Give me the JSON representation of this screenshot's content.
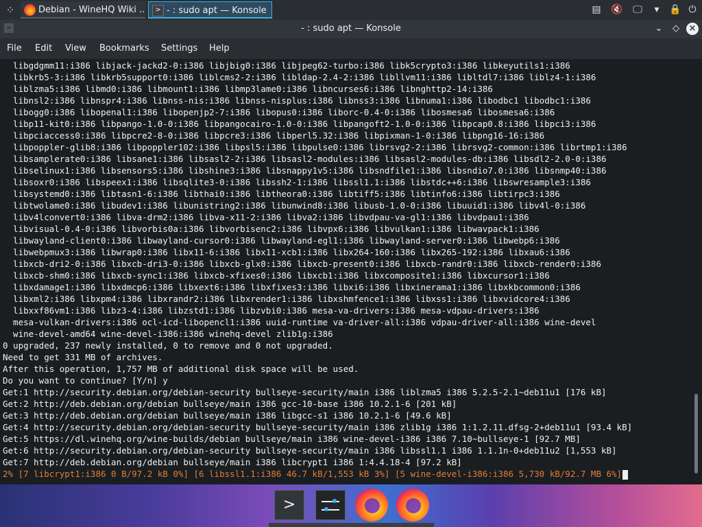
{
  "taskbar": {
    "tasks": [
      {
        "label": "Debian - WineHQ Wiki ..."
      },
      {
        "label": "- : sudo apt — Konsole"
      }
    ]
  },
  "window": {
    "title": "- : sudo apt — Konsole"
  },
  "menu": [
    "File",
    "Edit",
    "View",
    "Bookmarks",
    "Settings",
    "Help"
  ],
  "terminal": {
    "lines": [
      "  libgdgmm11:i386 libjack-jackd2-0:i386 libjbig0:i386 libjpeg62-turbo:i386 libk5crypto3:i386 libkeyutils1:i386",
      "  libkrb5-3:i386 libkrb5support0:i386 liblcms2-2:i386 libldap-2.4-2:i386 libllvm11:i386 libltdl7:i386 liblz4-1:i386",
      "  liblzma5:i386 libmd0:i386 libmount1:i386 libmp3lame0:i386 libncurses6:i386 libnghttp2-14:i386",
      "  libnsl2:i386 libnspr4:i386 libnss-nis:i386 libnss-nisplus:i386 libnss3:i386 libnuma1:i386 libodbc1 libodbc1:i386",
      "  libogg0:i386 libopenal1:i386 libopenjp2-7:i386 libopus0:i386 liborc-0.4-0:i386 libosmesa6 libosmesa6:i386",
      "  libp11-kit0:i386 libpango-1.0-0:i386 libpangocairo-1.0-0:i386 libpangoft2-1.0-0:i386 libpcap0.8:i386 libpci3:i386",
      "  libpciaccess0:i386 libpcre2-8-0:i386 libpcre3:i386 libperl5.32:i386 libpixman-1-0:i386 libpng16-16:i386",
      "  libpoppler-glib8:i386 libpoppler102:i386 libpsl5:i386 libpulse0:i386 librsvg2-2:i386 librsvg2-common:i386 librtmp1:i386",
      "  libsamplerate0:i386 libsane1:i386 libsasl2-2:i386 libsasl2-modules:i386 libsasl2-modules-db:i386 libsdl2-2.0-0:i386",
      "  libselinux1:i386 libsensors5:i386 libshine3:i386 libsnappy1v5:i386 libsndfile1:i386 libsndio7.0:i386 libsnmp40:i386",
      "  libsoxr0:i386 libspeex1:i386 libsqlite3-0:i386 libssh2-1:i386 libssl1.1:i386 libstdc++6:i386 libswresample3:i386",
      "  libsystemd0:i386 libtasn1-6:i386 libthai0:i386 libtheora0:i386 libtiff5:i386 libtinfo6:i386 libtirpc3:i386",
      "  libtwolame0:i386 libudev1:i386 libunistring2:i386 libunwind8:i386 libusb-1.0-0:i386 libuuid1:i386 libv4l-0:i386",
      "  libv4lconvert0:i386 libva-drm2:i386 libva-x11-2:i386 libva2:i386 libvdpau-va-gl1:i386 libvdpau1:i386",
      "  libvisual-0.4-0:i386 libvorbis0a:i386 libvorbisenc2:i386 libvpx6:i386 libvulkan1:i386 libwavpack1:i386",
      "  libwayland-client0:i386 libwayland-cursor0:i386 libwayland-egl1:i386 libwayland-server0:i386 libwebp6:i386",
      "  libwebpmux3:i386 libwrap0:i386 libx11-6:i386 libx11-xcb1:i386 libx264-160:i386 libx265-192:i386 libxau6:i386",
      "  libxcb-dri2-0:i386 libxcb-dri3-0:i386 libxcb-glx0:i386 libxcb-present0:i386 libxcb-randr0:i386 libxcb-render0:i386",
      "  libxcb-shm0:i386 libxcb-sync1:i386 libxcb-xfixes0:i386 libxcb1:i386 libxcomposite1:i386 libxcursor1:i386",
      "  libxdamage1:i386 libxdmcp6:i386 libxext6:i386 libxfixes3:i386 libxi6:i386 libxinerama1:i386 libxkbcommon0:i386",
      "  libxml2:i386 libxpm4:i386 libxrandr2:i386 libxrender1:i386 libxshmfence1:i386 libxss1:i386 libxvidcore4:i386",
      "  libxxf86vm1:i386 libz3-4:i386 libzstd1:i386 libzvbi0:i386 mesa-va-drivers:i386 mesa-vdpau-drivers:i386",
      "  mesa-vulkan-drivers:i386 ocl-icd-libopencl1:i386 uuid-runtime va-driver-all:i386 vdpau-driver-all:i386 wine-devel",
      "  wine-devel-amd64 wine-devel-i386:i386 winehq-devel zlib1g:i386",
      "0 upgraded, 237 newly installed, 0 to remove and 0 not upgraded.",
      "Need to get 331 MB of archives.",
      "After this operation, 1,757 MB of additional disk space will be used.",
      "Do you want to continue? [Y/n] y",
      "Get:1 http://security.debian.org/debian-security bullseye-security/main i386 liblzma5 i386 5.2.5-2.1~deb11u1 [176 kB]",
      "Get:2 http://deb.debian.org/debian bullseye/main i386 gcc-10-base i386 10.2.1-6 [201 kB]",
      "Get:3 http://deb.debian.org/debian bullseye/main i386 libgcc-s1 i386 10.2.1-6 [49.6 kB]",
      "Get:4 http://security.debian.org/debian-security bullseye-security/main i386 zlib1g i386 1:1.2.11.dfsg-2+deb11u1 [93.4 kB]",
      "Get:5 https://dl.winehq.org/wine-builds/debian bullseye/main i386 wine-devel-i386 i386 7.10~bullseye-1 [92.7 MB]",
      "Get:6 http://security.debian.org/debian-security bullseye-security/main i386 libssl1.1 i386 1.1.1n-0+deb11u2 [1,553 kB]",
      "Get:7 http://deb.debian.org/debian bullseye/main i386 libcrypt1 i386 1:4.4.18-4 [97.2 kB]"
    ],
    "progress_line": "2% [7 libcrypt1:i386 0 B/97.2 kB 0%] [6 libssl1.1:i386 46.7 kB/1,553 kB 3%] [5 wine-devel-i386:i386 5,730 kB/92.7 MB 6%]",
    "progress_color": "#e07d3c"
  },
  "icons": {
    "launcher": "kde-launcher-icon",
    "firefox": "firefox-icon",
    "konsole": "konsole-icon",
    "clipboard": "clipboard-icon",
    "volume": "volume-muted-icon",
    "network": "network-icon",
    "lock": "lock-icon",
    "power": "power-icon"
  }
}
